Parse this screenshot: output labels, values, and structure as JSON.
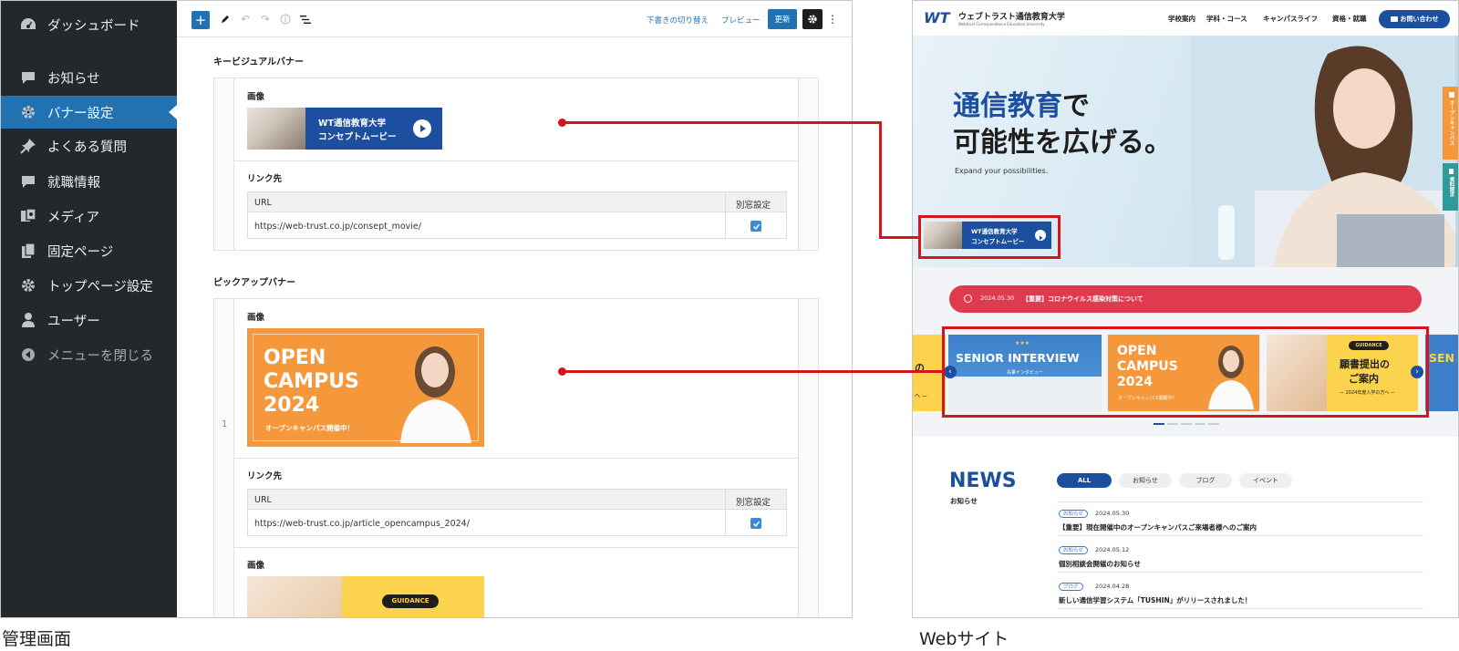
{
  "admin": {
    "caption": "管理画面",
    "sidebar": {
      "items": [
        {
          "label": "ダッシュボード",
          "icon": "dashboard-icon"
        },
        {
          "label": "お知らせ",
          "icon": "comment-icon"
        },
        {
          "label": "バナー設定",
          "icon": "gear-icon",
          "active": true
        },
        {
          "label": "よくある質問",
          "icon": "pin-icon"
        },
        {
          "label": "就職情報",
          "icon": "comment-icon"
        },
        {
          "label": "メディア",
          "icon": "media-icon"
        },
        {
          "label": "固定ページ",
          "icon": "pages-icon"
        },
        {
          "label": "トップページ設定",
          "icon": "gear-icon"
        },
        {
          "label": "ユーザー",
          "icon": "user-icon"
        },
        {
          "label": "メニューを閉じる",
          "icon": "collapse-icon"
        }
      ]
    },
    "toolbar": {
      "switch_draft_label": "下書きの切り替え",
      "preview_label": "プレビュー",
      "update_label": "更新"
    },
    "key_visual": {
      "section_label": "キービジュアルバナー",
      "image_label": "画像",
      "banner_line1": "WT通信教育大学",
      "banner_line2": "コンセプトムービー",
      "link_label": "リンク先",
      "url_header": "URL",
      "window_header": "別窓設定",
      "url_value": "https://web-trust.co.jp/consept_movie/",
      "new_window": true
    },
    "pickup": {
      "section_label": "ピックアップバナー",
      "row_number": "1",
      "image_label": "画像",
      "banner_line1": "OPEN",
      "banner_line2": "CAMPUS",
      "banner_line3": "2024",
      "banner_sub": "オープンキャンパス開催中！",
      "link_label": "リンク先",
      "url_header": "URL",
      "window_header": "別窓設定",
      "url_value": "https://web-trust.co.jp/article_opencampus_2024/",
      "new_window": true,
      "image2_label": "画像",
      "guidance_badge": "GUIDANCE"
    }
  },
  "website": {
    "caption": "Webサイト",
    "logo_mark": "WT",
    "logo_name": "ウェブトラスト通信教育大学",
    "logo_sub": "Webtrust Correspondence Education University",
    "nav": [
      "学校案内",
      "学科・コース",
      "キャンパスライフ",
      "資格・就職"
    ],
    "contact_label": "お問い合わせ",
    "hero": {
      "headline_accent": "通信教育",
      "headline_rest1": "で",
      "headline_line2": "可能性を広げる。",
      "sub": "Expand your possibilities.",
      "banner_line1": "WT通信教育大学",
      "banner_line2": "コンセプトムービー"
    },
    "side_tabs": [
      "オープンキャンパス",
      "資料請求"
    ],
    "alert": {
      "date": "2024.05.30",
      "text": "【重要】コロナウイルス感染対策について"
    },
    "pickup": {
      "left_partial": "の",
      "left_partial2": "へ —",
      "senior_title": "SENIOR INTERVIEW",
      "senior_sub": "先輩インタビュー",
      "oc_line1": "OPEN",
      "oc_line2": "CAMPUS",
      "oc_line3": "2024",
      "oc_sub": "オープンキャンパス開催中！",
      "guidance_badge": "GUIDANCE",
      "guidance_title1": "願書提出の",
      "guidance_title2": "ご案内",
      "guidance_sub": "— 2024年度入学の方へ —",
      "right_partial": "SEN"
    },
    "news": {
      "title": "NEWS",
      "subtitle": "お知らせ",
      "filters": [
        "ALL",
        "お知らせ",
        "ブログ",
        "イベント"
      ],
      "items": [
        {
          "tag": "お知らせ",
          "date": "2024.05.30",
          "title": "【重要】現在開催中のオープンキャンパスご来場者様へのご案内"
        },
        {
          "tag": "お知らせ",
          "date": "2024.05.12",
          "title": "個別相談会開催のお知らせ"
        },
        {
          "tag": "ブログ",
          "date": "2024.04.28",
          "title": "新しい通信学習システム「TUSHIN」がリリースされました！"
        }
      ]
    }
  }
}
